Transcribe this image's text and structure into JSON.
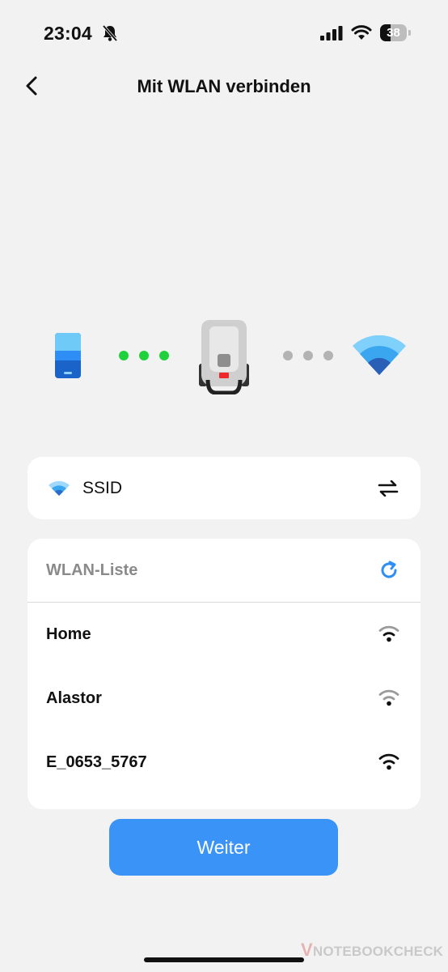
{
  "status_bar": {
    "time": "23:04",
    "battery_level": "38",
    "icons": [
      "bell-slash-icon",
      "cellular-signal-icon",
      "wifi-icon",
      "battery-icon"
    ]
  },
  "nav": {
    "title": "Mit WLAN verbinden",
    "back_icon": "chevron-left-icon"
  },
  "illustration": {
    "left_step": "phone",
    "middle_step": "robot-mower",
    "right_step": "router",
    "colors": {
      "connected_dots": "#1fd13a",
      "pending_dots": "#b3b3b3",
      "phone": "#2f8ef5",
      "router": "#5fbff5"
    }
  },
  "ssid": {
    "label": "SSID",
    "icon": "wifi-icon",
    "action_icon": "swap-arrows-icon"
  },
  "wlan_list": {
    "title": "WLAN-Liste",
    "refresh_icon": "refresh-icon",
    "networks": [
      {
        "name": "Home",
        "signal": "strong"
      },
      {
        "name": "Alastor",
        "signal": "medium"
      },
      {
        "name": "E_0653_5767",
        "signal": "strong"
      }
    ]
  },
  "primary_button": {
    "label": "Weiter",
    "color": "#3a93f7"
  },
  "watermark": {
    "text": "NOTEBOOKCHECK",
    "prefix": "V"
  }
}
